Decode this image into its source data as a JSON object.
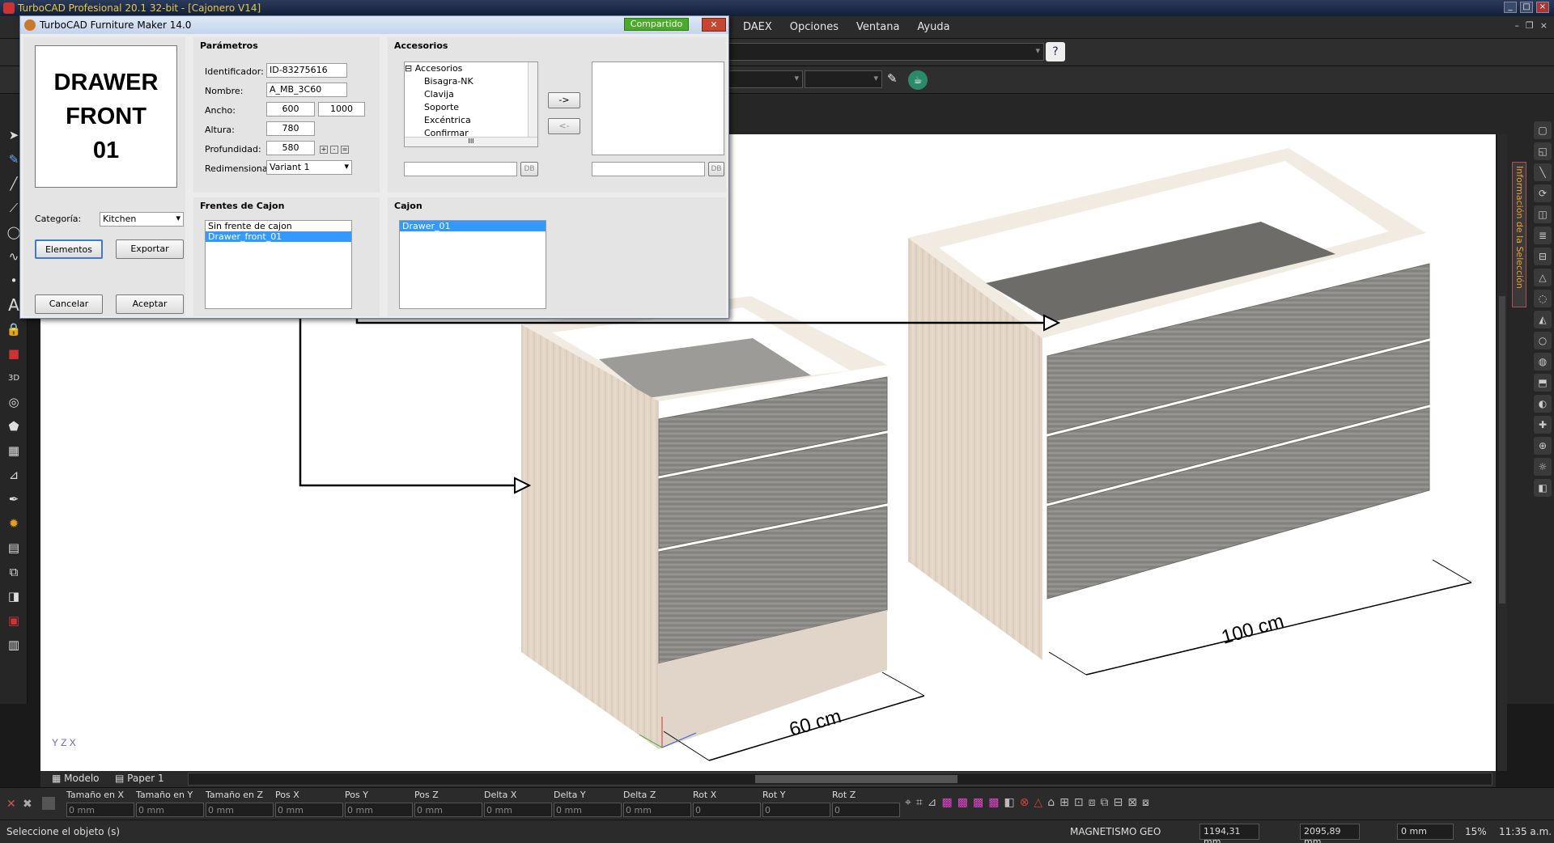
{
  "app": {
    "title": "TurboCAD Profesional 20.1 32-bit - [Cajonero V14]"
  },
  "menu": {
    "items": [
      "DAEX",
      "Opciones",
      "Ventana",
      "Ayuda"
    ]
  },
  "dialog": {
    "title": "TurboCAD Furniture Maker 14.0",
    "shared_badge": "Compartido",
    "close_label": "✕",
    "preview": {
      "line1": "DRAWER",
      "line2": "FRONT",
      "line3": "01"
    },
    "category": {
      "label": "Categoría:",
      "value": "Kitchen"
    },
    "buttons": {
      "elements": "Elementos",
      "export": "Exportar",
      "cancel": "Cancelar",
      "accept": "Aceptar",
      "add": "->",
      "remove": "<-",
      "db1": "DB",
      "db2": "DB"
    },
    "params": {
      "title": "Parámetros",
      "id_label": "Identificador:",
      "id_value": "ID-83275616",
      "name_label": "Nombre:",
      "name_value": "A_MB_3C60",
      "width_label": "Ancho:",
      "width_value": "600",
      "width_alt_value": "1000",
      "height_label": "Altura:",
      "height_value": "780",
      "depth_label": "Profundidad:",
      "depth_value": "580",
      "resize_label": "Redimensionar:",
      "resize_value": "Variant 1"
    },
    "accessories": {
      "title": "Accesorios",
      "root": "Accesorios",
      "items": [
        "Bisagra-NK",
        "Clavija",
        "Soporte",
        "Excéntrica",
        "Confirmar"
      ],
      "hscroll_label": "III"
    },
    "drawer_fronts": {
      "title": "Frentes de Cajon",
      "items": [
        "Sin frente de cajon",
        "Drawer_front_01"
      ],
      "selected": 1
    },
    "drawer": {
      "title": "Cajon",
      "items": [
        "Drawer_01"
      ],
      "selected": 0
    }
  },
  "viewport": {
    "dim_left": "60 cm",
    "dim_right": "100 cm",
    "axis_label": "Y Z X"
  },
  "tabs": [
    "Modelo",
    "Paper 1"
  ],
  "coords": {
    "fields": [
      {
        "label": "Tamaño en X",
        "value": "0 mm"
      },
      {
        "label": "Tamaño en Y",
        "value": "0 mm"
      },
      {
        "label": "Tamaño en Z",
        "value": "0 mm"
      },
      {
        "label": "Pos X",
        "value": "0 mm"
      },
      {
        "label": "Pos Y",
        "value": "0 mm"
      },
      {
        "label": "Pos Z",
        "value": "0 mm"
      },
      {
        "label": "Delta X",
        "value": "0 mm"
      },
      {
        "label": "Delta Y",
        "value": "0 mm"
      },
      {
        "label": "Delta Z",
        "value": "0 mm"
      },
      {
        "label": "Rot X",
        "value": "0"
      },
      {
        "label": "Rot Y",
        "value": "0"
      },
      {
        "label": "Rot Z",
        "value": "0"
      }
    ]
  },
  "status": {
    "prompt": "Seleccione el objeto (s)",
    "magnetism": "MAGNETISMO",
    "geo": "GEO",
    "x": "1194,31 mm",
    "y": "2095,89 mm",
    "z": "0 mm",
    "zoom": "15%",
    "time": "11:35 a.m."
  },
  "side_panel": {
    "label": "Información de la Selección"
  },
  "colors": {
    "accent": "#3399ff",
    "shared": "#4caa2a",
    "title_text": "#e8c84a"
  }
}
